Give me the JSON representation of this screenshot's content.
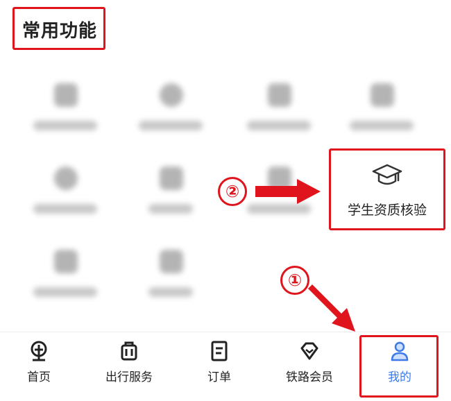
{
  "section": {
    "title": "常用功能"
  },
  "student_verify": {
    "label": "学生资质核验",
    "icon": "graduation-cap-icon"
  },
  "annotations": {
    "step1": "①",
    "step2": "②",
    "highlight_color": "#e0141c"
  },
  "tabs": [
    {
      "label": "首页",
      "icon": "train-logo-icon",
      "active": false
    },
    {
      "label": "出行服务",
      "icon": "luggage-icon",
      "active": false
    },
    {
      "label": "订单",
      "icon": "order-icon",
      "active": false
    },
    {
      "label": "铁路会员",
      "icon": "diamond-icon",
      "active": false
    },
    {
      "label": "我的",
      "icon": "person-icon",
      "active": true
    }
  ],
  "colors": {
    "active_tab": "#3b7ae8",
    "text": "#222222"
  }
}
